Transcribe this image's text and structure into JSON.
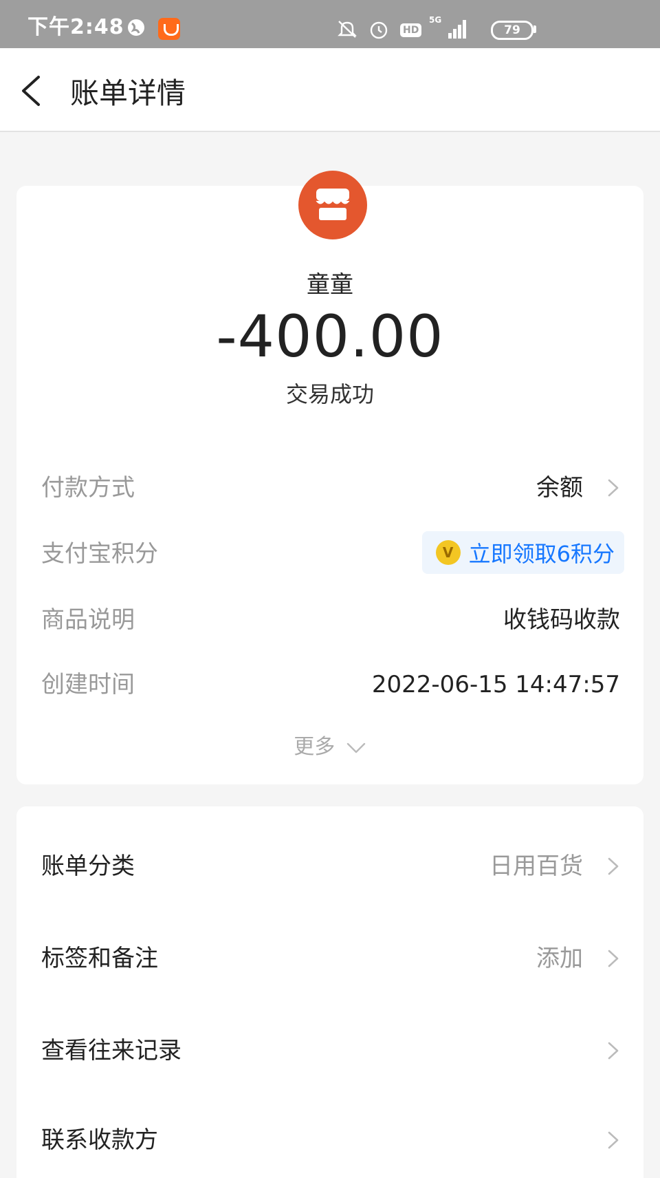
{
  "status_bar": {
    "time": "下午2:48",
    "battery": "79",
    "network": "5G",
    "hd": "HD"
  },
  "header": {
    "title": "账单详情"
  },
  "bill": {
    "merchant": "童童",
    "amount": "-400.00",
    "status": "交易成功",
    "brand_color": "#e4572e"
  },
  "details": {
    "payment_method_label": "付款方式",
    "payment_method_value": "余额",
    "points_label": "支付宝积分",
    "points_value": "立即领取6积分",
    "product_label": "商品说明",
    "product_value": "收钱码收款",
    "created_label": "创建时间",
    "created_value": "2022-06-15 14:47:57",
    "more_label": "更多"
  },
  "actions": {
    "category_label": "账单分类",
    "category_value": "日用百货",
    "tags_label": "标签和备注",
    "tags_value": "添加",
    "history_label": "查看往来记录",
    "contact_label": "联系收款方"
  },
  "icons": {
    "back": "back-arrow-icon",
    "merchant": "store-icon",
    "chevron": "chevron-right-icon",
    "coin": "points-coin-icon"
  },
  "colors": {
    "link_blue": "#1677ff",
    "coin": "#f3c623"
  }
}
